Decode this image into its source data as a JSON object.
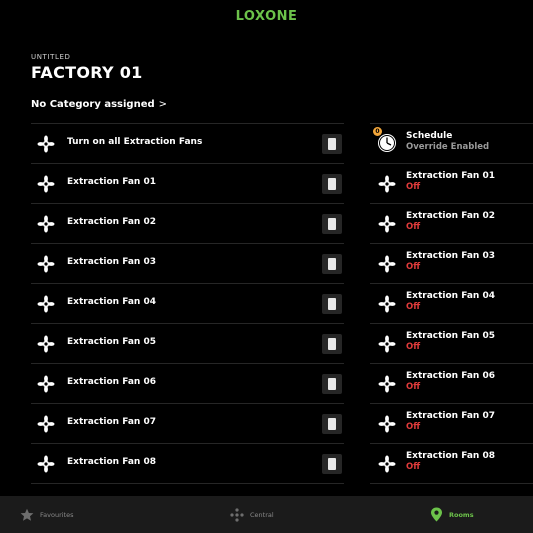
{
  "brand": "LOXONE",
  "page": {
    "kicker": "UNTITLED",
    "title": "FACTORY 01",
    "category": "No Category assigned",
    "category_chevron": ">"
  },
  "controls": [
    {
      "label": "Turn on all Extraction Fans",
      "state": "off"
    },
    {
      "label": "Extraction Fan 01",
      "state": "off"
    },
    {
      "label": "Extraction Fan 02",
      "state": "off"
    },
    {
      "label": "Extraction Fan 03",
      "state": "off"
    },
    {
      "label": "Extraction Fan 04",
      "state": "off"
    },
    {
      "label": "Extraction Fan 05",
      "state": "off"
    },
    {
      "label": "Extraction Fan 06",
      "state": "off"
    },
    {
      "label": "Extraction Fan 07",
      "state": "off"
    },
    {
      "label": "Extraction Fan 08",
      "state": "off"
    }
  ],
  "schedule": {
    "label": "Schedule",
    "status": "Override Enabled",
    "badge": "0",
    "icon": "clock-icon"
  },
  "status_list": [
    {
      "label": "Extraction Fan 01",
      "status": "Off"
    },
    {
      "label": "Extraction Fan 02",
      "status": "Off"
    },
    {
      "label": "Extraction Fan 03",
      "status": "Off"
    },
    {
      "label": "Extraction Fan 04",
      "status": "Off"
    },
    {
      "label": "Extraction Fan 05",
      "status": "Off"
    },
    {
      "label": "Extraction Fan 06",
      "status": "Off"
    },
    {
      "label": "Extraction Fan 07",
      "status": "Off"
    },
    {
      "label": "Extraction Fan 08",
      "status": "Off"
    }
  ],
  "tabs": [
    {
      "label": "Favourites",
      "icon": "star-icon",
      "active": false
    },
    {
      "label": "Central",
      "icon": "central-dots-icon",
      "active": false
    },
    {
      "label": "Rooms",
      "icon": "location-pin-icon",
      "active": true
    }
  ],
  "colors": {
    "brand_green": "#6cc24a",
    "off_red": "#e23b3b",
    "badge_orange": "#f3a73b"
  }
}
